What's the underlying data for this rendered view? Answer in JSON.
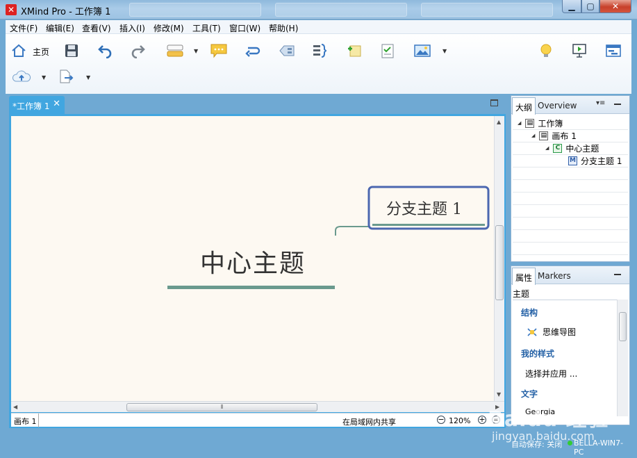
{
  "window": {
    "title": "XMind Pro - 工作簿 1"
  },
  "menu": [
    {
      "label": "文件(F)"
    },
    {
      "label": "编辑(E)"
    },
    {
      "label": "查看(V)"
    },
    {
      "label": "插入(I)"
    },
    {
      "label": "修改(M)"
    },
    {
      "label": "工具(T)"
    },
    {
      "label": "窗口(W)"
    },
    {
      "label": "帮助(H)"
    }
  ],
  "toolbar": {
    "home_label": "主页"
  },
  "editor": {
    "tab_label": "*工作簿 1"
  },
  "map": {
    "central_topic": "中心主题",
    "branch_topic": "分支主题 1",
    "branch_color": "#4b67b0",
    "line_color": "#6a9a8e"
  },
  "status": {
    "sheet_tab": "画布 1",
    "share": "在局域网内共享",
    "zoom": "120%"
  },
  "outline_panel": {
    "tab_outline": "大纲",
    "tab_overview": "Overview",
    "tree": [
      {
        "label": "工作簿",
        "icon": "workbook-icon"
      },
      {
        "label": "画布 1",
        "icon": "sheet-icon"
      },
      {
        "label": "中心主题",
        "icon": "central-topic-icon",
        "badge": "C"
      },
      {
        "label": "分支主题 1",
        "icon": "main-topic-icon",
        "badge": "M"
      }
    ]
  },
  "props_panel": {
    "tab_props": "属性",
    "tab_markers": "Markers",
    "subtitle": "主题",
    "structure_title": "结构",
    "structure_value": "思维导图",
    "style_title": "我的样式",
    "style_value": "选择并应用 ...",
    "text_title": "文字",
    "font_value": "Georgia"
  },
  "bottom_status": {
    "autosave": "自动保存: 关闭",
    "machine": "BELLA-WIN7-PC"
  },
  "watermark": {
    "text": "Baidu 经验",
    "url": "jingyan.baidu.com"
  }
}
